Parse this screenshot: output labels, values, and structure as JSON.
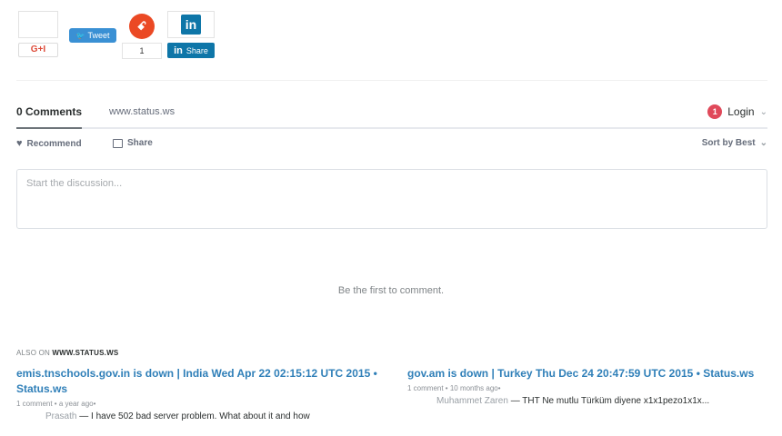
{
  "share": {
    "gplus_label": "G+I",
    "tweet_label": "Tweet",
    "stumble_glyph": "ꗃ",
    "stumble_count": "1",
    "linkedin_logo": "in",
    "linkedin_share": "Share",
    "colors": {
      "tweet": "#3a90d4",
      "stumble": "#eb4924",
      "linkedin": "#0e76a8",
      "gplus": "#dd4b39"
    }
  },
  "comments": {
    "tab_active": "0 Comments",
    "tab_site": "www.status.ws",
    "login_badge": "1",
    "login_label": "Login",
    "recommend_label": "Recommend",
    "share_label": "Share",
    "sort_label": "Sort by Best",
    "discussion_placeholder": "Start the discussion...",
    "empty_message": "Be the first to comment."
  },
  "also_on": {
    "prefix": "ALSO ON",
    "site": "WWW.STATUS.WS",
    "items": [
      {
        "title": "emis.tnschools.gov.in is down | India Wed Apr 22 02:15:12 UTC 2015 • Status.ws",
        "meta": "1 comment • a year ago•",
        "author": "Prasath",
        "text": "— I have 502 bad server problem. What about it and how"
      },
      {
        "title": "gov.am is down | Turkey Thu Dec 24 20:47:59 UTC 2015 • Status.ws",
        "meta": "1 comment • 10 months ago•",
        "author": "Muhammet Zaren",
        "text": "— THT Ne mutlu Türküm diyene x1x1pezo1x1x..."
      }
    ]
  }
}
